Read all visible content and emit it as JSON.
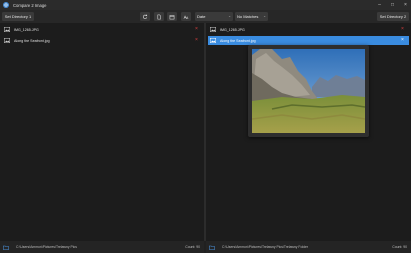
{
  "window": {
    "title": "Compare 2 Image",
    "icon": "app-icon",
    "controls": [
      "minimize-icon",
      "maximize-icon",
      "close-icon"
    ]
  },
  "toolbar": {
    "set_dir_1": "Set Directory 1",
    "set_dir_2": "Set Directory 2",
    "icons": [
      "refresh-icon",
      "document-icon",
      "calendar-icon",
      "font-size-icon"
    ],
    "sort_select": "Date",
    "filter_select": "No Matches"
  },
  "left_list": {
    "items": [
      {
        "name": "IMG_1265.JPG"
      },
      {
        "name": "Along the Seafront.jpg"
      }
    ]
  },
  "right_list": {
    "items": [
      {
        "name": "IMG_1265.JPG"
      },
      {
        "name": "Along the Seafront.jpg",
        "selected": true
      }
    ]
  },
  "status_left": {
    "path": "C:\\Users\\Ammon\\Pictures\\Trelawny Pics",
    "count": "Count: 90"
  },
  "status_right": {
    "path": "C:\\Users\\Ammon\\Pictures\\Trelawny Pics\\Trelawny Folder",
    "count": "Count: 90"
  },
  "colors": {
    "accent": "#3a8ce0",
    "delete": "#e04040",
    "background": "#202020"
  }
}
